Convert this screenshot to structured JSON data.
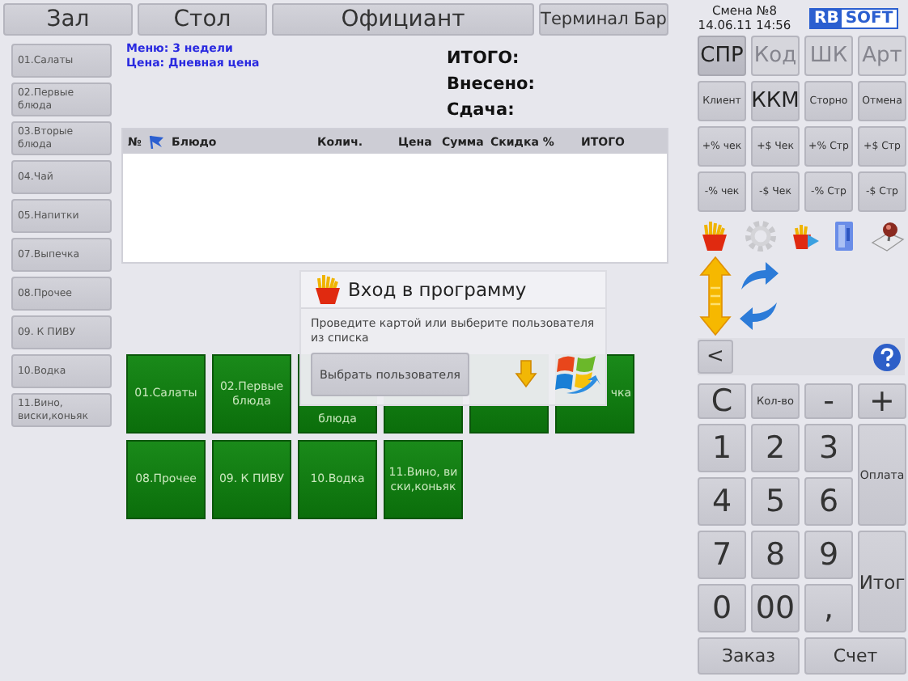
{
  "top_buttons": [
    "Зал",
    "Стол",
    "Официант",
    "Терминал Бар"
  ],
  "menu_info": [
    "Меню: 3 недели",
    "Цена: Дневная цена"
  ],
  "totals": [
    "ИТОГО:",
    "Внесено:",
    "Сдача:"
  ],
  "categories": [
    "01.Салаты",
    "02.Первые блюда",
    "03.Вторые блюда",
    "04.Чай",
    "05.Напитки",
    "07.Выпечка",
    "08.Прочее",
    "09. К ПИВУ",
    "10.Водка",
    "11.Вино, виски,коньяк"
  ],
  "table": {
    "columns": [
      "№",
      "Блюдо",
      "Колич.",
      "Цена",
      "Сумма",
      "Скидка %",
      "ИТОГО"
    ]
  },
  "tiles": [
    {
      "label": "01.Салаты",
      "kind": "whole"
    },
    {
      "label": "02.Первые блюда",
      "kind": "whole"
    },
    {
      "label": "блюда",
      "kind": "cut-top"
    },
    {
      "kind": "hidden"
    },
    {
      "kind": "hidden"
    },
    {
      "label": "чка",
      "kind": "cut-left"
    },
    {
      "label": "08.Прочее",
      "kind": "whole"
    },
    {
      "label": "09. К ПИВУ",
      "kind": "whole"
    },
    {
      "label": "10.Водка",
      "kind": "whole"
    },
    {
      "label": "11.Вино, виски,коньяк",
      "kind": "whole"
    }
  ],
  "login_dialog": {
    "title": "Вход в программу",
    "message": "Проведите картой или выберите пользователя из списка",
    "button": "Выбрать пользователя"
  },
  "shift": {
    "label": "Смена №8",
    "datetime": "14.06.11 14:56"
  },
  "logo": [
    "RB",
    "SOFT"
  ],
  "mode_buttons": [
    {
      "label": "СПР",
      "selected": true
    },
    {
      "label": "Код",
      "selected": false
    },
    {
      "label": "ШК",
      "selected": false
    },
    {
      "label": "Арт",
      "selected": false
    }
  ],
  "function_buttons": [
    {
      "label": "Клиент",
      "kind": "small"
    },
    {
      "label": "ККМ",
      "kind": "large"
    },
    {
      "label": "Сторно",
      "kind": "small"
    },
    {
      "label": "Отмена",
      "kind": "small"
    },
    {
      "label": "+% чек",
      "kind": "small"
    },
    {
      "label": "+$ Чек",
      "kind": "small"
    },
    {
      "label": "+% Стр",
      "kind": "small"
    },
    {
      "label": "+$ Стр",
      "kind": "small"
    },
    {
      "label": "-% чек",
      "kind": "small"
    },
    {
      "label": "-$ Чек",
      "kind": "small"
    },
    {
      "label": "-% Стр",
      "kind": "small"
    },
    {
      "label": "-$ Стр",
      "kind": "small"
    }
  ],
  "back_key": "<",
  "keypad": [
    {
      "label": "C",
      "kind": "key"
    },
    {
      "label": "Кол-во",
      "kind": "small"
    },
    {
      "label": "-",
      "kind": "key"
    },
    {
      "label": "+",
      "kind": "key"
    },
    {
      "label": "1",
      "kind": "key"
    },
    {
      "label": "2",
      "kind": "key"
    },
    {
      "label": "3",
      "kind": "key"
    },
    {
      "label": "Оплата",
      "kind": "tall-small"
    },
    {
      "label": "4",
      "kind": "key"
    },
    {
      "label": "5",
      "kind": "key"
    },
    {
      "label": "6",
      "kind": "key"
    },
    {
      "label": "7",
      "kind": "key"
    },
    {
      "label": "8",
      "kind": "key"
    },
    {
      "label": "9",
      "kind": "key"
    },
    {
      "label": "Итог",
      "kind": "tall"
    },
    {
      "label": "0",
      "kind": "key"
    },
    {
      "label": "00",
      "kind": "key"
    },
    {
      "label": ",",
      "kind": "key"
    }
  ],
  "bottom_buttons": [
    "Заказ",
    "Счет"
  ]
}
